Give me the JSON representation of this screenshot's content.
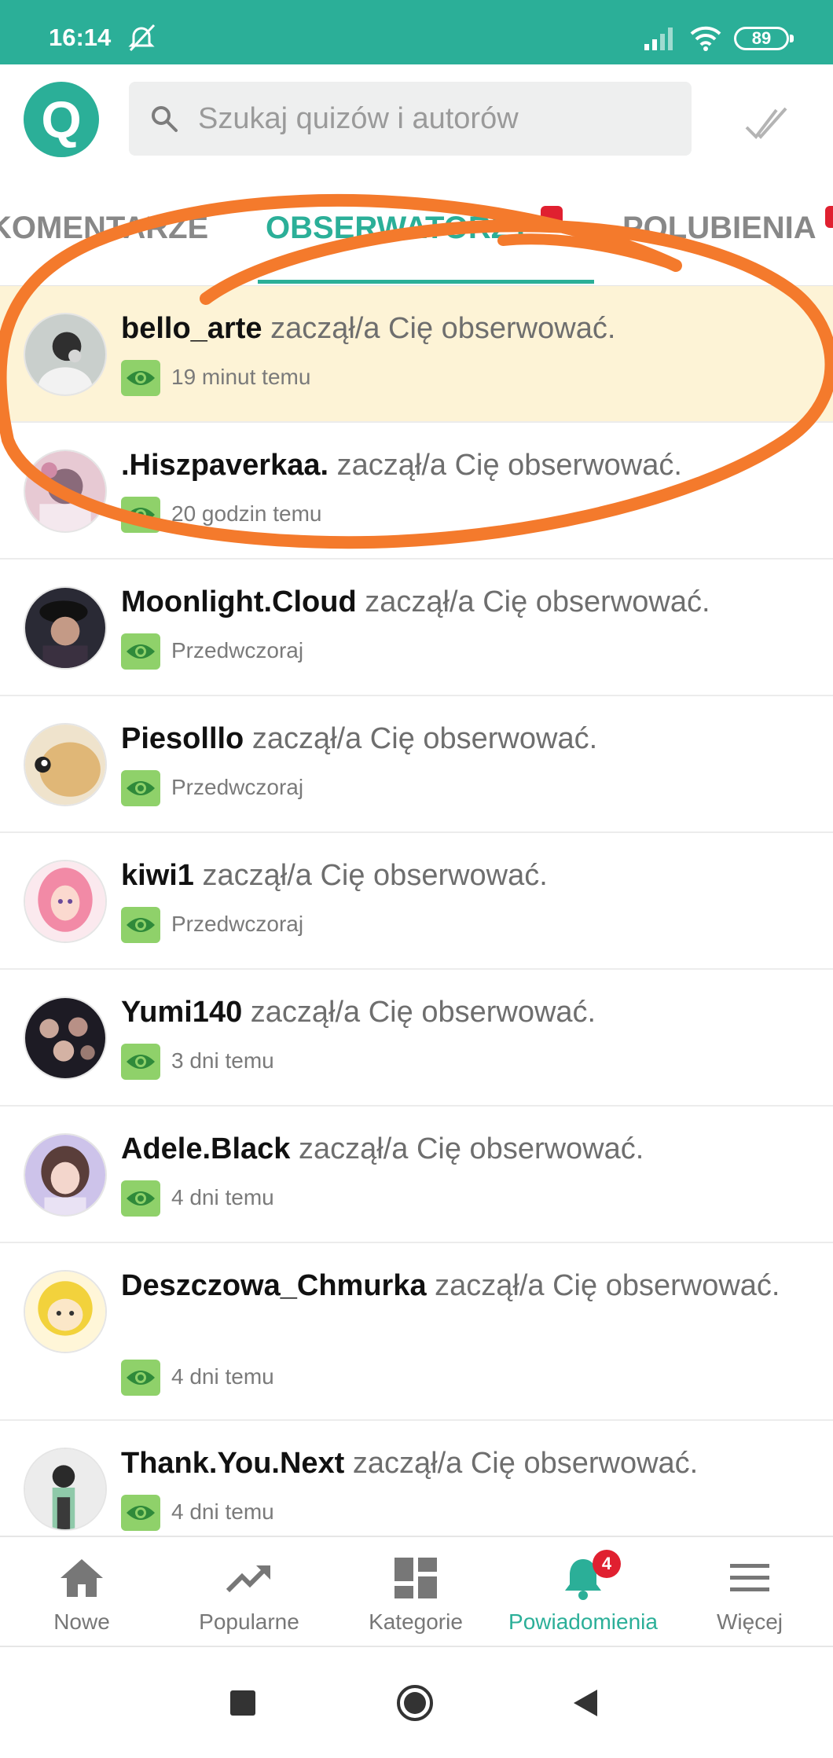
{
  "status_bar": {
    "time": "16:14",
    "battery": "89"
  },
  "header": {
    "logo_letter": "Q",
    "search_placeholder": "Szukaj quizów i autorów"
  },
  "tabs": [
    {
      "label": "KOMENTARZE"
    },
    {
      "label": "OBSERWATORZY"
    },
    {
      "label": "POLUBIENIA"
    }
  ],
  "notifications": [
    {
      "user": "bello_arte",
      "action": "zaczął/a Cię obserwować.",
      "time": "19 minut temu"
    },
    {
      "user": ".Hiszpaverkaa.",
      "action": "zaczął/a Cię obserwować.",
      "time": "20 godzin temu"
    },
    {
      "user": "Moonlight.Cloud",
      "action": "zaczął/a Cię obserwować.",
      "time": "Przedwczoraj"
    },
    {
      "user": "Piesolllo",
      "action": "zaczął/a Cię obserwować.",
      "time": "Przedwczoraj"
    },
    {
      "user": "kiwi1",
      "action": "zaczął/a Cię obserwować.",
      "time": "Przedwczoraj"
    },
    {
      "user": "Yumi140",
      "action": "zaczął/a Cię obserwować.",
      "time": "3 dni temu"
    },
    {
      "user": "Adele.Black",
      "action": "zaczął/a Cię obserwować.",
      "time": "4 dni temu"
    },
    {
      "user": "Deszczowa_Chmurka",
      "action": "zaczął/a Cię obserwować.",
      "time": "4 dni temu"
    },
    {
      "user": "Thank.You.Next",
      "action": "zaczął/a Cię obserwować.",
      "time": "4 dni temu"
    }
  ],
  "bottom_nav": [
    {
      "label": "Nowe",
      "icon": "home-icon"
    },
    {
      "label": "Popularne",
      "icon": "trending-icon"
    },
    {
      "label": "Kategorie",
      "icon": "categories-icon"
    },
    {
      "label": "Powiadomienia",
      "icon": "bell-icon",
      "badge": "4"
    },
    {
      "label": "Więcej",
      "icon": "menu-icon"
    }
  ],
  "colors": {
    "accent": "#2baf98",
    "highlight": "#fdf3d6",
    "badge": "#e02030",
    "eye_chip": "#8fd16a",
    "scribble": "#f47a2c"
  }
}
